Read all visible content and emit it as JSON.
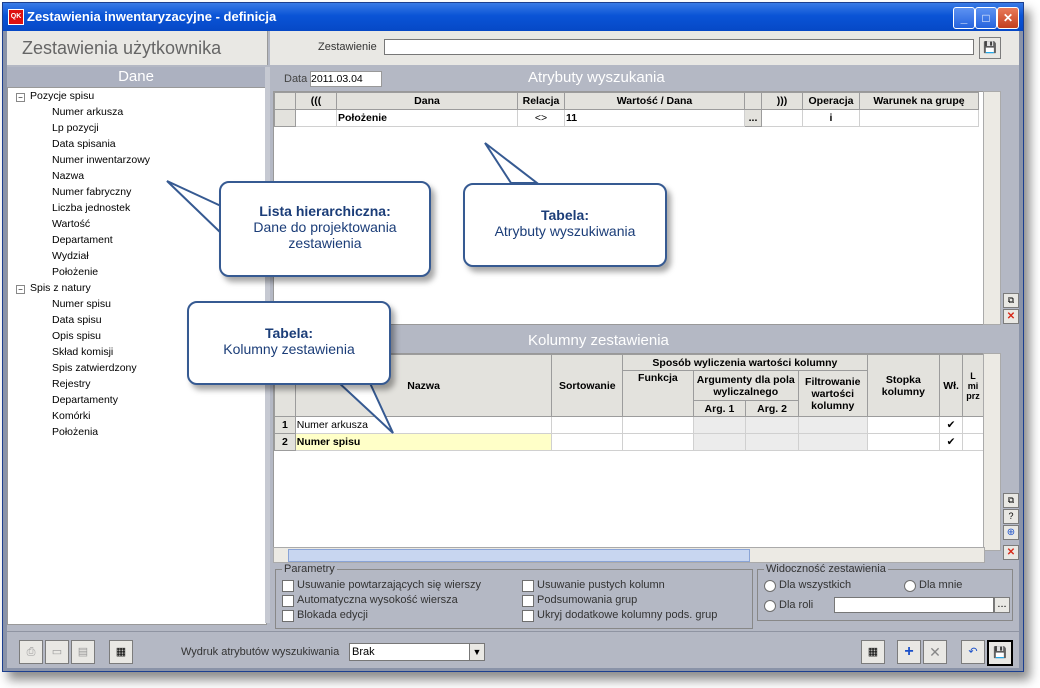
{
  "window": {
    "title": "Zestawienia inwentaryzacyjne - definicja",
    "app_icon": "app-icon"
  },
  "header": {
    "section_title": "Zestawienia użytkownika",
    "zestawienie_label": "Zestawienie",
    "zestawienie_value": ""
  },
  "left": {
    "title": "Dane",
    "tree": [
      {
        "label": "Pozycje spisu",
        "children": [
          "Numer arkusza",
          "Lp pozycji",
          "Data spisania",
          "Numer inwentarzowy",
          "Nazwa",
          "Numer fabryczny",
          "Liczba jednostek",
          "Wartość",
          "Departament",
          "Wydział",
          "Położenie"
        ]
      },
      {
        "label": "Spis z natury",
        "children": [
          "Numer spisu",
          "Data spisu",
          "Opis spisu",
          "Skład komisji",
          "Spis zatwierdzony",
          "Rejestry",
          "Departamenty",
          "Komórki",
          "Położenia"
        ]
      }
    ]
  },
  "search": {
    "date_label": "Data",
    "date_value": "2011.03.04",
    "title": "Atrybuty wyszukania",
    "columns": [
      "(((",
      "Dana",
      "Relacja",
      "Wartość / Dana",
      "",
      ")))",
      "Operacja",
      "Warunek na grupę"
    ],
    "rows": [
      {
        "open": "",
        "dana": "Położenie",
        "relacja": "<>",
        "wartosc": "11",
        "btn": "...",
        "close": "",
        "operacja": "i",
        "warunek": ""
      }
    ]
  },
  "columns_section": {
    "title": "Kolumny zestawienia",
    "headers": {
      "nazwa": "Nazwa",
      "sortowanie": "Sortowanie",
      "sposob": "Sposób wyliczenia wartości kolumny",
      "funkcja": "Funkcja",
      "argumenty": "Argumenty dla pola wyliczalnego",
      "arg1": "Arg. 1",
      "arg2": "Arg. 2",
      "filtrowanie": "Filtrowanie wartości kolumny",
      "stopka": "Stopka kolumny",
      "wl": "Wł.",
      "extra": "L mi prz"
    },
    "rows": [
      {
        "num": "1",
        "nazwa": "Numer arkusza",
        "wl": "✔"
      },
      {
        "num": "2",
        "nazwa": "Numer spisu",
        "wl": "✔"
      }
    ]
  },
  "callouts": {
    "tree": {
      "title": "Lista hierarchiczna:",
      "text": "Dane do projektowania zestawienia"
    },
    "search": {
      "title": "Tabela:",
      "text": "Atrybuty wyszukiwania"
    },
    "columns": {
      "title": "Tabela:",
      "text": "Kolumny zestawienia"
    }
  },
  "parametry": {
    "title": "Parametry",
    "options": [
      "Usuwanie powtarzających się wierszy",
      "Automatyczna wysokość wiersza",
      "Blokada edycji",
      "Usuwanie pustych kolumn",
      "Podsumowania grup",
      "Ukryj dodatkowe kolumny pods. grup"
    ]
  },
  "widocznosc": {
    "title": "Widoczność zestawienia",
    "options": [
      "Dla wszystkich",
      "Dla mnie",
      "Dla roli"
    ],
    "roli_value": "",
    "btn": "..."
  },
  "footer": {
    "wydruk_label": "Wydruk atrybutów wyszukiwania",
    "wydruk_value": "Brak"
  },
  "colors": {
    "title_bar": "#0a54d6",
    "panel_header": "#acb1c0",
    "highlight_row": "#ffffc8",
    "callout_border": "#365a92"
  }
}
